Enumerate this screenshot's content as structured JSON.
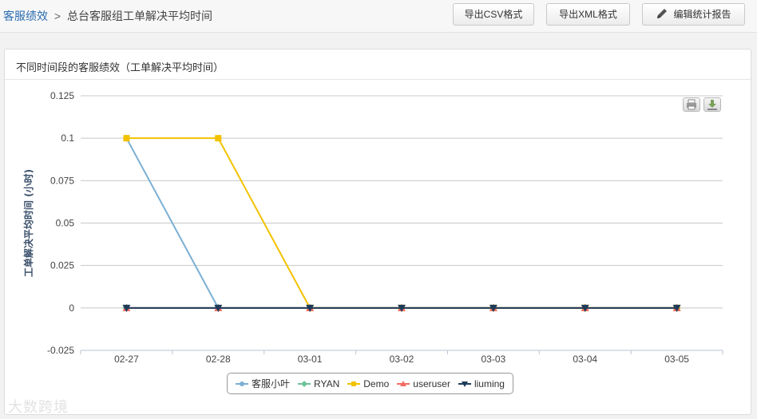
{
  "breadcrumb": {
    "link": "客服绩效",
    "separator": ">",
    "current": "总台客服组工单解决平均时间"
  },
  "toolbar": {
    "export_csv": "导出CSV格式",
    "export_xml": "导出XML格式",
    "edit_report": "编辑统计报告"
  },
  "panel": {
    "title": "不同时间段的客服绩效（工单解决平均时间）"
  },
  "watermark": "大数跨境",
  "chart_data": {
    "type": "line",
    "ylabel": "工单解决平均时间 (小时)",
    "xlabel": "",
    "categories": [
      "02-27",
      "02-28",
      "03-01",
      "03-02",
      "03-03",
      "03-04",
      "03-05"
    ],
    "ylim": [
      -0.025,
      0.125
    ],
    "yticks": [
      {
        "value": 0.125,
        "label": "0.125"
      },
      {
        "value": 0.1,
        "label": "0.1"
      },
      {
        "value": 0.075,
        "label": "0.075"
      },
      {
        "value": 0.05,
        "label": "0.05"
      },
      {
        "value": 0.025,
        "label": "0.025"
      },
      {
        "value": 0,
        "label": "0"
      },
      {
        "value": -0.025,
        "label": "-0.025"
      }
    ],
    "grid": true,
    "legend_position": "bottom",
    "series": [
      {
        "name": "客服小叶",
        "color": "#7bafd4",
        "marker": "circle",
        "values": [
          0.1,
          0,
          0,
          0,
          0,
          0,
          0
        ]
      },
      {
        "name": "RYAN",
        "color": "#6dc199",
        "marker": "diamond",
        "values": [
          0,
          0,
          0,
          0,
          0,
          0,
          0
        ]
      },
      {
        "name": "Demo",
        "color": "#f2c200",
        "marker": "square",
        "values": [
          0.1,
          0.1,
          0,
          0,
          0,
          0,
          0
        ]
      },
      {
        "name": "useruser",
        "color": "#f26c63",
        "marker": "triangle",
        "values": [
          0,
          0,
          0,
          0,
          0,
          0,
          0
        ]
      },
      {
        "name": "liuming",
        "color": "#1e3c5a",
        "marker": "triangle-down",
        "values": [
          0,
          0,
          0,
          0,
          0,
          0,
          0
        ]
      }
    ]
  }
}
